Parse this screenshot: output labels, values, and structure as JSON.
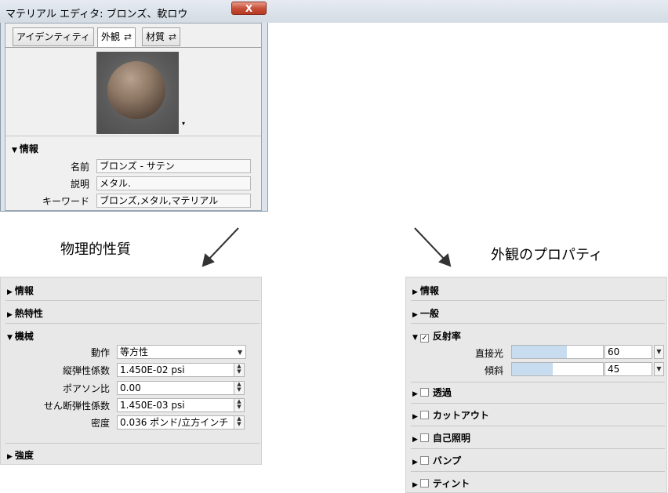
{
  "window": {
    "title": "マテリアル エディタ: ブロンズ、軟ロウ",
    "close_label": "X",
    "tabs": [
      {
        "label": "アイデンティティ",
        "active": false
      },
      {
        "label": "外観",
        "active": true,
        "icon": "swap-arrows-icon",
        "icon_glyph": "⇄"
      },
      {
        "label": "材質",
        "active": false,
        "icon": "swap-arrows-icon",
        "icon_glyph": "⇄"
      }
    ],
    "preview_dropdown_glyph": "▾",
    "info": {
      "heading": "情報",
      "fields": [
        {
          "label": "名前",
          "value": "ブロンズ - サテン"
        },
        {
          "label": "説明",
          "value": "メタル."
        },
        {
          "label": "キーワード",
          "value": "ブロンズ,メタル,マテリアル"
        }
      ]
    }
  },
  "captions": {
    "left": "物理的性質",
    "right": "外観のプロパティ"
  },
  "physical": {
    "sections": [
      {
        "label": "情報",
        "expanded": false
      },
      {
        "label": "熱特性",
        "expanded": false
      },
      {
        "label": "機械",
        "expanded": true
      },
      {
        "label": "強度",
        "expanded": false
      }
    ],
    "props": [
      {
        "label": "動作",
        "value": "等方性",
        "control": "dropdown"
      },
      {
        "label": "縦弾性係数",
        "value": "1.450E-02 psi",
        "control": "spinner"
      },
      {
        "label": "ポアソン比",
        "value": "0.00",
        "control": "spinner"
      },
      {
        "label": "せん断弾性係数",
        "value": "1.450E-03 psi",
        "control": "spinner"
      },
      {
        "label": "密度",
        "value": "0.036 ポンド/立方インチ",
        "control": "spinner"
      }
    ]
  },
  "appearance": {
    "sections": [
      {
        "label": "情報",
        "expanded": false,
        "checkbox": false
      },
      {
        "label": "一般",
        "expanded": false,
        "checkbox": false
      },
      {
        "label": "反射率",
        "expanded": true,
        "checkbox": true,
        "checked": true
      },
      {
        "label": "透過",
        "expanded": false,
        "checkbox": true,
        "checked": false
      },
      {
        "label": "カットアウト",
        "expanded": false,
        "checkbox": true,
        "checked": false
      },
      {
        "label": "自己照明",
        "expanded": false,
        "checkbox": true,
        "checked": false
      },
      {
        "label": "バンプ",
        "expanded": false,
        "checkbox": true,
        "checked": false
      },
      {
        "label": "ティント",
        "expanded": false,
        "checkbox": true,
        "checked": false
      }
    ],
    "sliders": [
      {
        "label": "直接光",
        "value": "60",
        "fraction": 0.6
      },
      {
        "label": "傾斜",
        "value": "45",
        "fraction": 0.45
      }
    ]
  },
  "colors": {
    "slider_fill": "#c8dcf0",
    "close_button": "#c8503a"
  }
}
